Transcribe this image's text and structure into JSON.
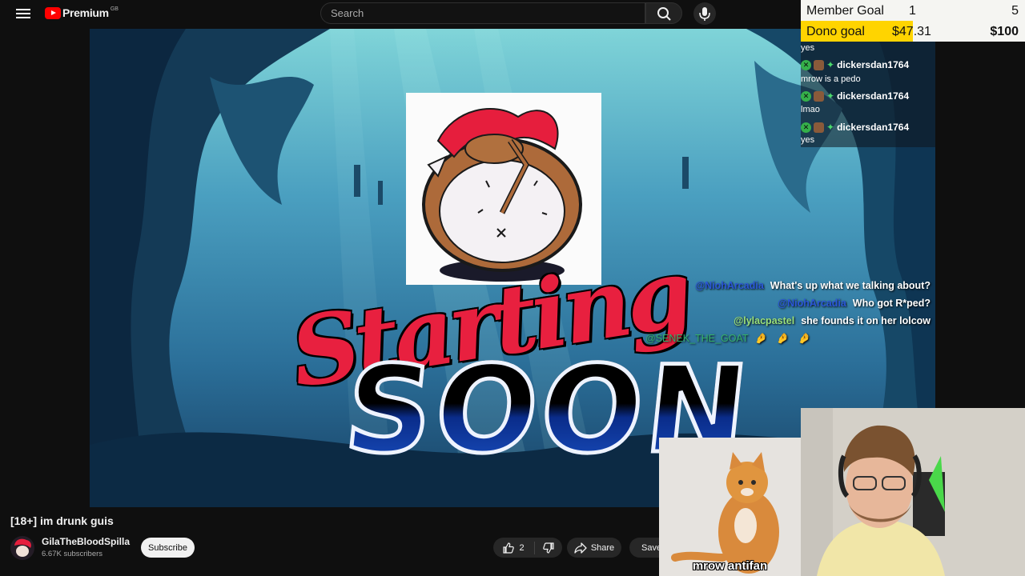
{
  "header": {
    "logo_text": "Premium",
    "logo_country": "GB",
    "search_placeholder": "Search"
  },
  "overlay": {
    "goals": {
      "member_label": "Member Goal",
      "member_current": "1",
      "member_target": "5",
      "dono_label": "Dono goal",
      "dono_current": "$47.31",
      "dono_target": "$100"
    },
    "chat_top": [
      {
        "type": "msg",
        "text": "yes"
      },
      {
        "type": "user",
        "name": "dickersdan1764"
      },
      {
        "type": "msg",
        "text": "mrow is a pedo"
      },
      {
        "type": "user",
        "name": "dickersdan1764"
      },
      {
        "type": "msg",
        "text": "lmao"
      },
      {
        "type": "user",
        "name": "dickersdan1764"
      },
      {
        "type": "msg",
        "text": "yes"
      }
    ],
    "chat_bottom": [
      {
        "name": "@NiohArcadia",
        "message": "What's up what we talking about?"
      },
      {
        "name": "@NiohArcadia",
        "message": "Who got R*ped?"
      },
      {
        "name": "@lylacpastel",
        "message": "she founds it on her lolcow"
      },
      {
        "name": "@SENEK_THE_GOAT",
        "message": "🤌 🤌 🤌"
      }
    ],
    "starting_text": "Starting",
    "soon_text": "SOON",
    "cat_caption": "mrow antifan"
  },
  "video": {
    "title": "[18+] im drunk guis",
    "channel_name": "GilaTheBloodSpilla",
    "subscribers": "6.67K subscribers",
    "subscribe_label": "Subscribe",
    "like_count": "2",
    "share_label": "Share",
    "save_label": "Save"
  }
}
